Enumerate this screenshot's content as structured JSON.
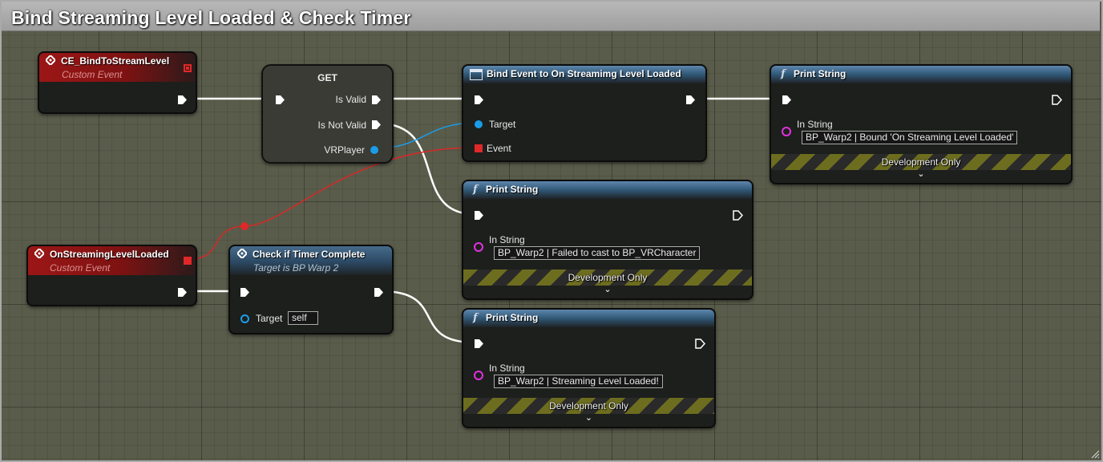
{
  "comment": {
    "title": "Bind Streaming Level Loaded & Check Timer"
  },
  "nodes": {
    "ce_bind": {
      "title": "CE_BindToStreamLevel",
      "subtitle": "Custom Event"
    },
    "get": {
      "title": "GET",
      "pins": {
        "is_valid": "Is Valid",
        "is_not_valid": "Is Not Valid",
        "vrplayer": "VRPlayer"
      }
    },
    "bind_event": {
      "title": "Bind Event to On Streamimg Level Loaded",
      "pins": {
        "target": "Target",
        "event": "Event"
      }
    },
    "print_bound": {
      "title": "Print String",
      "in_string_label": "In String",
      "in_string_value": "BP_Warp2 | Bound 'On Streaming Level Loaded'",
      "dev_only": "Development Only"
    },
    "print_failed": {
      "title": "Print String",
      "in_string_label": "In String",
      "in_string_value": "BP_Warp2 | Failed to cast to BP_VRCharacter",
      "dev_only": "Development Only"
    },
    "on_streaming": {
      "title": "OnStreamingLevelLoaded",
      "subtitle": "Custom Event"
    },
    "check_timer": {
      "title": "Check if Timer Complete",
      "subtitle": "Target is BP Warp 2",
      "target_label": "Target",
      "target_value": "self"
    },
    "print_loaded": {
      "title": "Print String",
      "in_string_label": "In String",
      "in_string_value": "BP_Warp2 | Streaming Level Loaded!",
      "dev_only": "Development Only"
    }
  },
  "icons": {
    "function": "f",
    "event": "event-diamond-icon",
    "chevron": "⌄"
  },
  "colors": {
    "exec": "#ffffff",
    "object": "#1a9de8",
    "delegate": "#e02828",
    "string": "#e032e0",
    "event_header": "#9c1616",
    "function_header": "#305776"
  }
}
